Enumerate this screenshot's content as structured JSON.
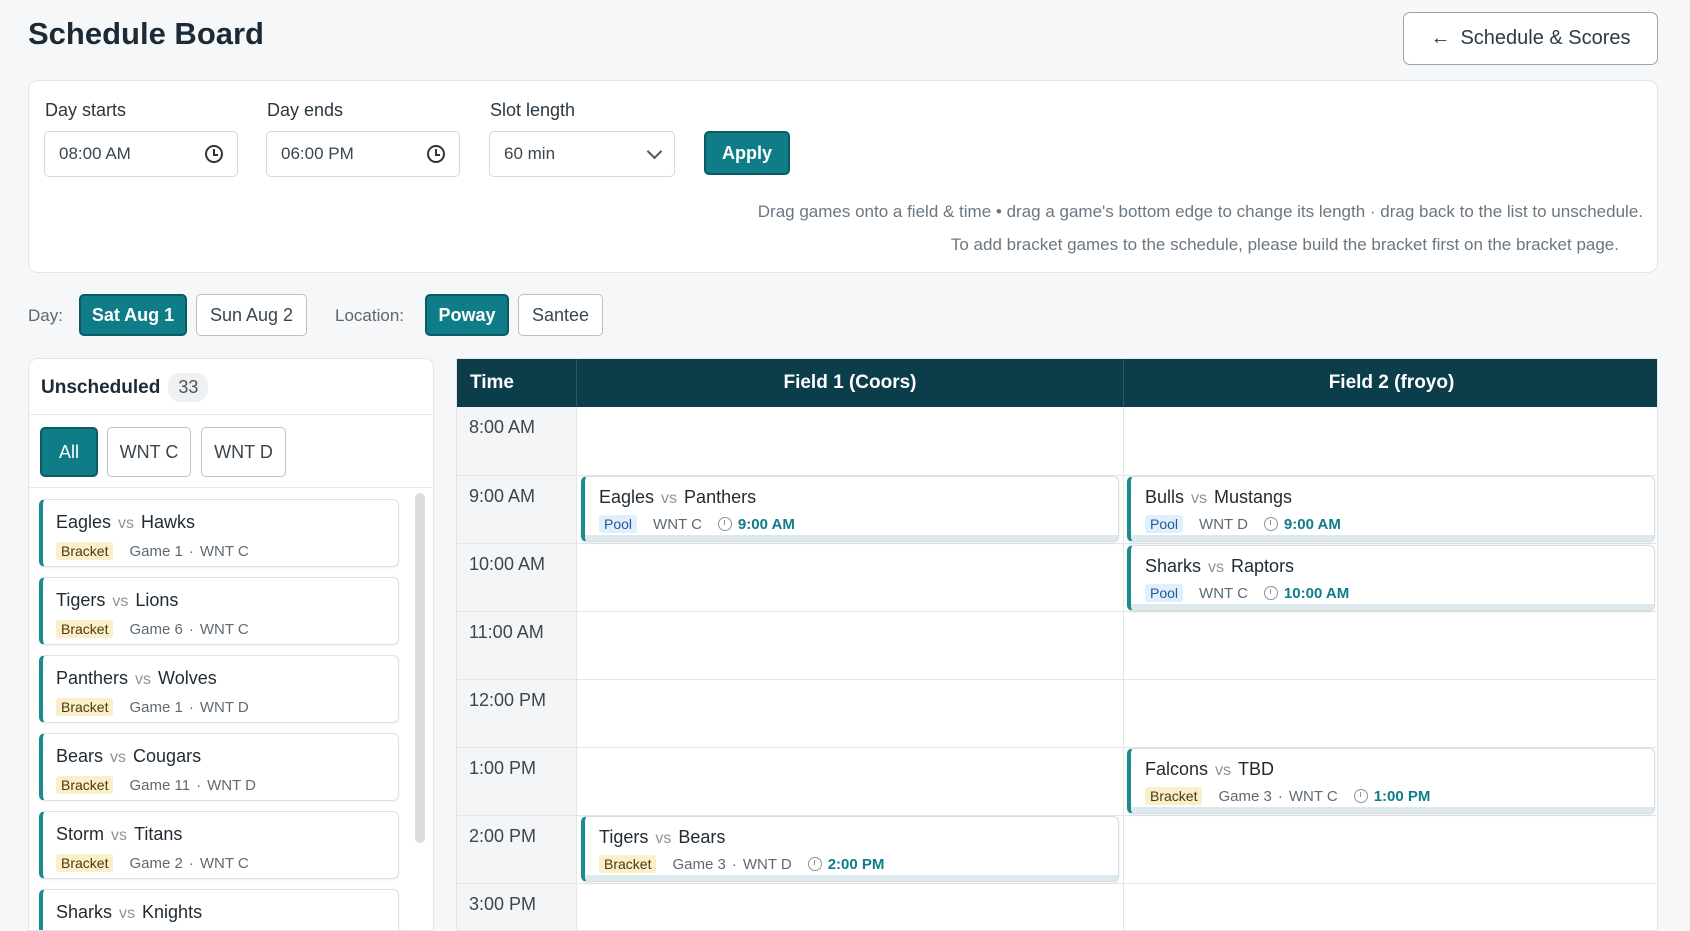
{
  "header": {
    "title": "Schedule Board",
    "back_label": "Schedule & Scores",
    "back_icon": "arrow-left-icon"
  },
  "settings": {
    "day_starts_label": "Day starts",
    "day_starts_value": "08:00  AM",
    "day_ends_label": "Day ends",
    "day_ends_value": "06:00  PM",
    "slot_label": "Slot length",
    "slot_value": "60 min",
    "apply_label": "Apply",
    "help_line1": "Drag games onto a field & time   •  drag a game's bottom edge  to  change  its  length · drag back to the list to unschedule.",
    "help_line2": "To add bracket games to the schedule, please build the bracket first on the bracket page."
  },
  "filters": {
    "day_label": "Day:",
    "days": [
      "Sat Aug 1",
      "Sun Aug 2"
    ],
    "location_label": "Location:",
    "locations": [
      "Poway",
      "Santee"
    ]
  },
  "unscheduled": {
    "title": "Unscheduled",
    "count": "33",
    "tabs": [
      "All",
      "WNT C",
      "WNT D"
    ],
    "vs": "vs",
    "items": [
      {
        "home": "Eagles",
        "away": "Hawks",
        "tag": "Bracket",
        "game": "Game 1",
        "division": "WNT C"
      },
      {
        "home": "Tigers",
        "away": "Lions",
        "tag": "Bracket",
        "game": "Game 6",
        "division": "WNT C"
      },
      {
        "home": "Panthers",
        "away": "Wolves",
        "tag": "Bracket",
        "game": "Game 1",
        "division": "WNT D"
      },
      {
        "home": "Bears",
        "away": "Cougars",
        "tag": "Bracket",
        "game": "Game 11",
        "division": "WNT D"
      },
      {
        "home": "Storm",
        "away": "Titans",
        "tag": "Bracket",
        "game": "Game 2",
        "division": "WNT C"
      },
      {
        "home": "Sharks",
        "away": "Knights",
        "tag": "",
        "game": "",
        "division": ""
      }
    ]
  },
  "board": {
    "time_header": "Time",
    "fields": [
      "Field 1 (Coors)",
      "Field 2 (froyo)"
    ],
    "times": [
      "8:00 AM",
      "9:00 AM",
      "10:00 AM",
      "11:00 AM",
      "12:00 PM",
      "1:00 PM",
      "2:00 PM",
      "3:00 PM"
    ],
    "games": [
      {
        "home": "Eagles",
        "away": "Panthers",
        "tag": "Pool",
        "game": "",
        "division": "WNT C",
        "time": "9:00 AM"
      },
      {
        "home": "Bulls",
        "away": "Mustangs",
        "tag": "Pool",
        "game": "",
        "division": "WNT D",
        "time": "9:00 AM"
      },
      {
        "home": "Sharks",
        "away": "Raptors",
        "tag": "Pool",
        "game": "",
        "division": "WNT C",
        "time": "10:00 AM"
      },
      {
        "home": "Falcons",
        "away": "TBD",
        "tag": "Bracket",
        "game": "Game 3",
        "division": "WNT C",
        "time": "1:00 PM"
      },
      {
        "home": "Tigers",
        "away": "Bears",
        "tag": "Bracket",
        "game": "Game 3",
        "division": "WNT D",
        "time": "2:00 PM"
      }
    ]
  },
  "colors": {
    "accent": "#0f7d87",
    "header_bg": "#0c3d4b",
    "bracket_tag": "#fbefc9",
    "pool_tag": "#e1eefb"
  }
}
